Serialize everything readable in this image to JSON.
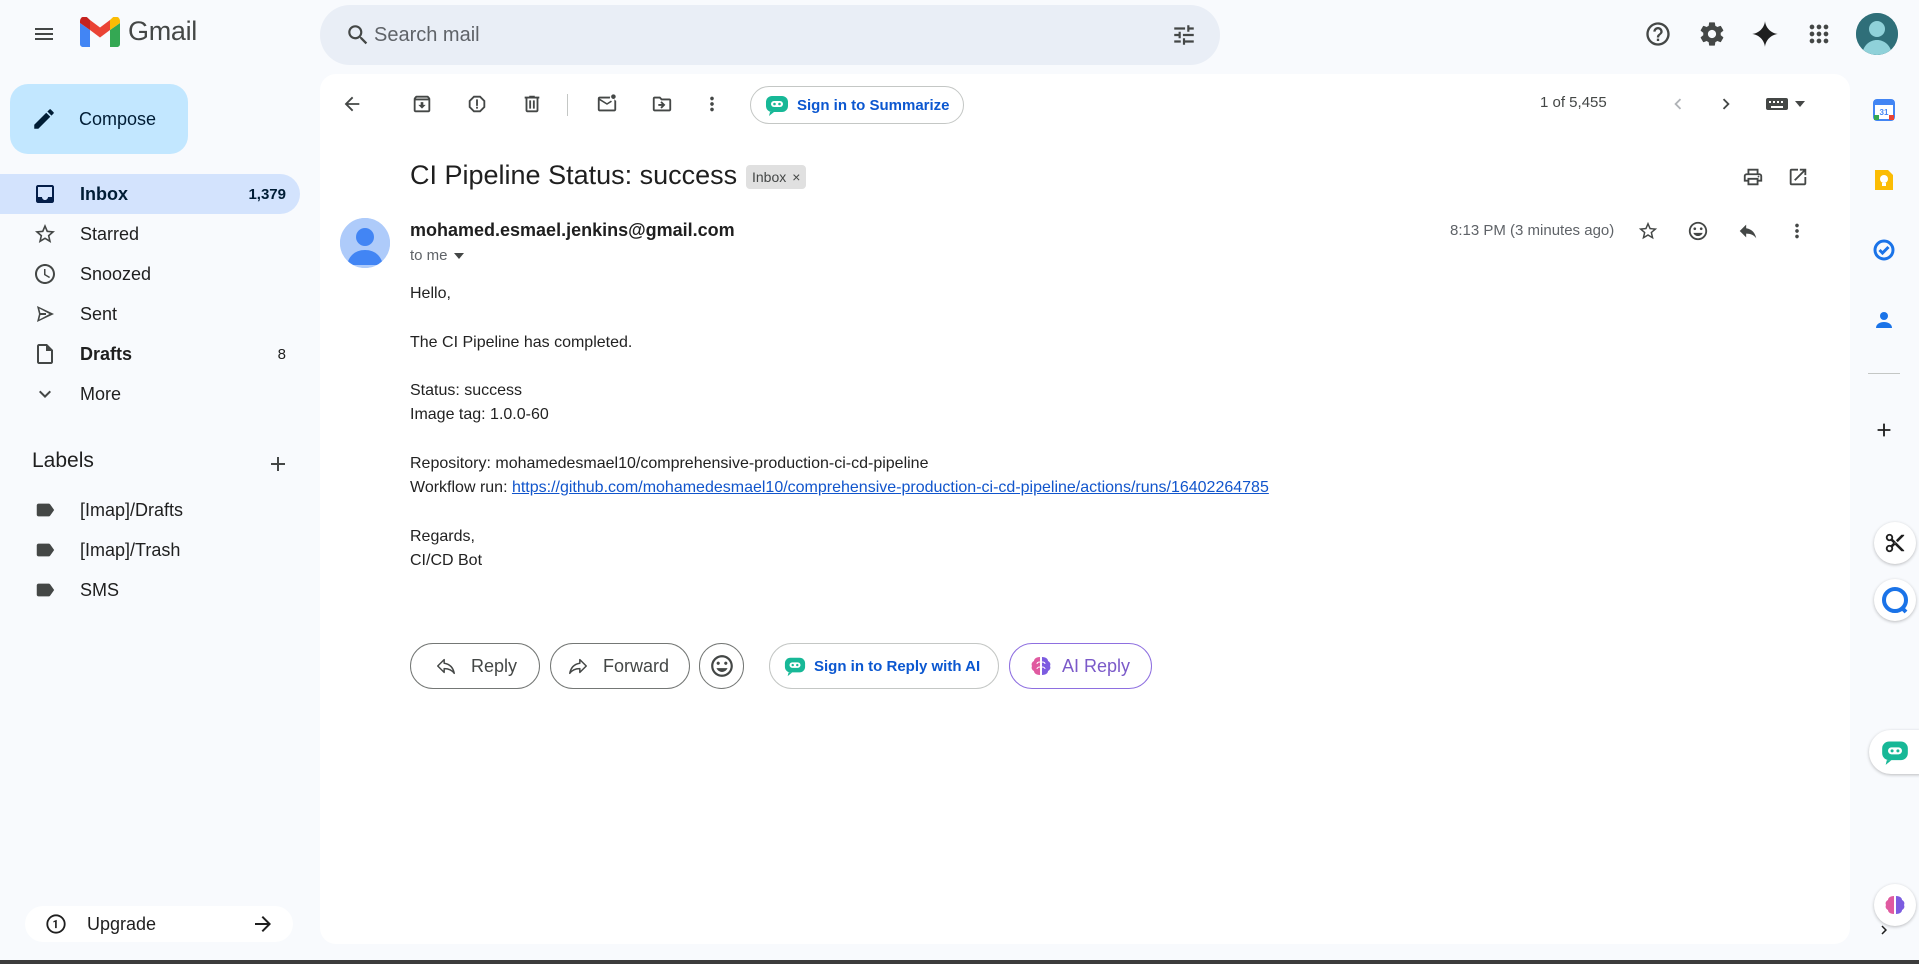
{
  "app": {
    "name": "Gmail"
  },
  "search": {
    "placeholder": "Search mail"
  },
  "sidebar": {
    "compose_label": "Compose",
    "items": [
      {
        "label": "Inbox",
        "count": "1,379"
      },
      {
        "label": "Starred",
        "count": ""
      },
      {
        "label": "Snoozed",
        "count": ""
      },
      {
        "label": "Sent",
        "count": ""
      },
      {
        "label": "Drafts",
        "count": "8"
      },
      {
        "label": "More",
        "count": ""
      }
    ],
    "labels_title": "Labels",
    "labels": [
      "[Imap]/Drafts",
      "[Imap]/Trash",
      "SMS"
    ],
    "upgrade_label": "Upgrade"
  },
  "toolbar": {
    "summarize_label": "Sign in to Summarize",
    "page_count": "1 of 5,455"
  },
  "message": {
    "subject": "CI Pipeline Status: success",
    "label_chip": "Inbox",
    "chip_close": "×",
    "sender": "mohamed.esmael.jenkins@gmail.com",
    "to": "to me",
    "timestamp": "8:13 PM (3 minutes ago)",
    "body": {
      "greeting": "Hello,",
      "line1": "The CI Pipeline has completed.",
      "status": "Status: success",
      "image_tag": "Image tag: 1.0.0-60",
      "repository": "Repository: mohamedesmael10/comprehensive-production-ci-cd-pipeline",
      "workflow_prefix": "Workflow run: ",
      "workflow_url": "https://github.com/mohamedesmael10/comprehensive-production-ci-cd-pipeline/actions/runs/16402264785",
      "regards": "Regards,",
      "signature": "CI/CD Bot"
    }
  },
  "actions": {
    "reply_label": "Reply",
    "forward_label": "Forward",
    "ai_signin_label": "Sign in to Reply with AI",
    "ai_reply_label": "AI Reply"
  },
  "colors": {
    "compose_bg": "#c2e7ff",
    "active_nav_bg": "#d3e3fd",
    "link": "#1155cc",
    "accent_blue": "#0b57d0",
    "ai_purple": "#7b5ac9"
  },
  "icons": [
    "menu-icon",
    "gmail-logo",
    "search-icon",
    "filter-icon",
    "help-icon",
    "settings-icon",
    "gemini-icon",
    "apps-icon",
    "pencil-icon",
    "inbox-icon",
    "star-icon",
    "clock-icon",
    "send-icon",
    "file-icon",
    "chevron-down-icon",
    "plus-icon",
    "label-icon",
    "upgrade-icon",
    "arrow-right-icon",
    "back-arrow-icon",
    "archive-icon",
    "report-spam-icon",
    "trash-icon",
    "mark-unread-icon",
    "move-to-icon",
    "more-vert-icon",
    "bot-icon",
    "chevron-left-icon",
    "chevron-right-icon",
    "keyboard-icon",
    "print-icon",
    "open-new-window-icon",
    "person-icon",
    "emoji-icon",
    "reply-icon",
    "forward-icon",
    "brain-icon",
    "calendar-icon",
    "keep-icon",
    "tasks-icon",
    "contacts-icon",
    "scissors-icon"
  ]
}
